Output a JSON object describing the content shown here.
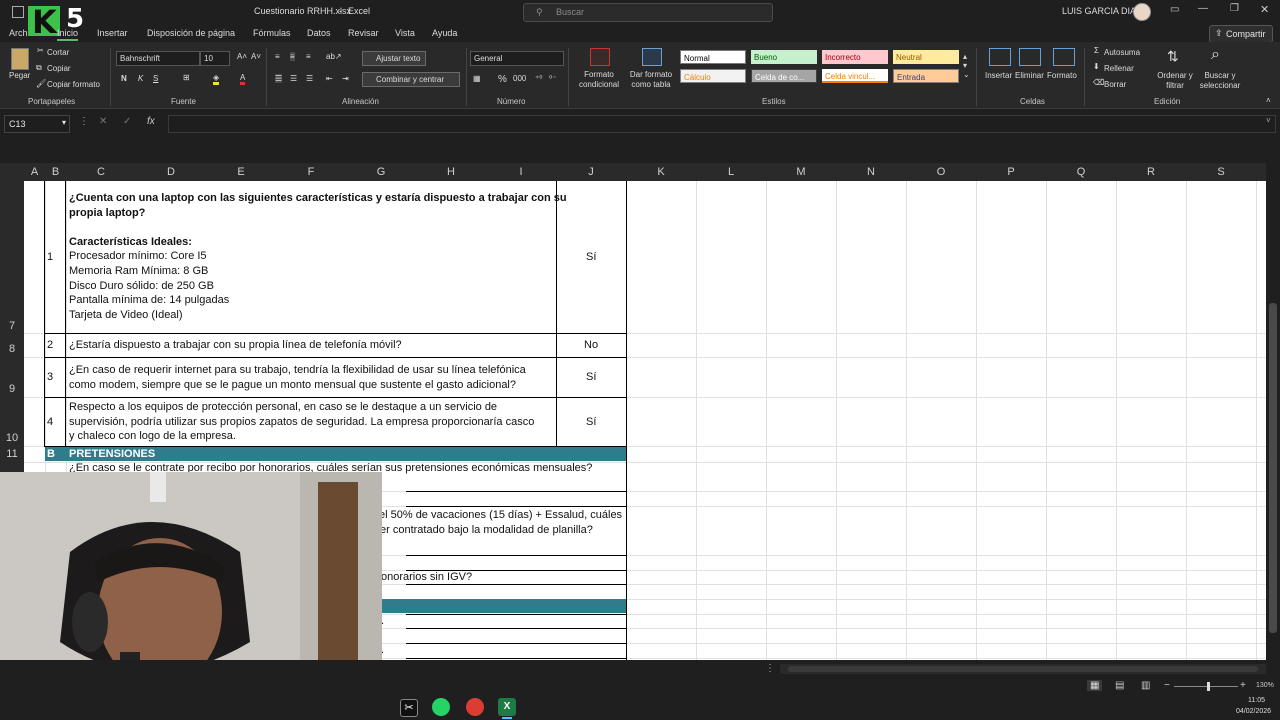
{
  "titlebar": {
    "filename": "Cuestionario RRHH.xlsx",
    "separator": "-",
    "app": "Excel",
    "search_placeholder": "Buscar",
    "user_name": "LUIS GARCIA DIAZ",
    "logo_letter": "K",
    "logo_number": "5"
  },
  "menu": {
    "items": [
      "Arch",
      "Inicio",
      "Insertar",
      "Disposición de página",
      "Fórmulas",
      "Datos",
      "Revisar",
      "Vista",
      "Ayuda"
    ],
    "share": "Compartir"
  },
  "ribbon": {
    "clipboard": {
      "paste": "Pegar",
      "cut": "Cortar",
      "copy": "Copiar",
      "format_painter": "Copiar formato",
      "group": "Portapapeles"
    },
    "font": {
      "name": "Bahnschrift",
      "size": "10",
      "bold": "N",
      "italic": "K",
      "underline": "S",
      "group": "Fuente"
    },
    "alignment": {
      "wrap": "Ajustar texto",
      "merge": "Combinar y centrar",
      "group": "Alineación"
    },
    "number": {
      "format": "General",
      "group": "Número"
    },
    "styles": {
      "conditional": "Formato condicional",
      "table": "Dar formato como tabla",
      "cells": [
        "Normal",
        "Bueno",
        "Incorrecto",
        "Neutral",
        "Cálculo",
        "Celda de co...",
        "Celda vincul...",
        "Entrada"
      ],
      "group": "Estilos"
    },
    "cells_group": {
      "insert": "Insertar",
      "delete": "Eliminar",
      "format": "Formato",
      "group": "Celdas"
    },
    "editing": {
      "autosum": "Autosuma",
      "fill": "Rellenar",
      "clear": "Borrar",
      "sort": "Ordenar y filtrar",
      "find": "Buscar y seleccionar",
      "group": "Edición"
    }
  },
  "formula_bar": {
    "cell_ref": "C13",
    "fx": "fx",
    "formula": ""
  },
  "columns": [
    "A",
    "B",
    "C",
    "D",
    "E",
    "F",
    "G",
    "H",
    "I",
    "J",
    "K",
    "L",
    "M",
    "N",
    "O",
    "P",
    "Q",
    "R",
    "S"
  ],
  "row_numbers": [
    "7",
    "8",
    "9",
    "10",
    "11"
  ],
  "questions": [
    {
      "num": "1",
      "lines": [
        "¿Cuenta con una laptop con las siguientes características y estaría dispuesto a trabajar con su",
        "propia laptop?",
        "",
        "Características Ideales:",
        "Procesador mínimo: Core I5",
        "Memoria Ram Mínima: 8 GB",
        "Disco Duro sólido: de 250 GB",
        "Pantalla mínima de: 14 pulgadas",
        "Tarjeta de Video (Ideal)"
      ],
      "answer": "Sí"
    },
    {
      "num": "2",
      "lines": [
        "¿Estaría dispuesto a trabajar con su propia línea de telefonía móvil?"
      ],
      "answer": "No"
    },
    {
      "num": "3",
      "lines": [
        "¿En caso de requerir internet para su trabajo, tendría la flexibilidad de usar su línea telefónica",
        "como modem, siempre que se le pague un monto mensual que sustente el gasto adicional?"
      ],
      "answer": "Sí"
    },
    {
      "num": "4",
      "lines": [
        "Respecto a los equipos de protección personal, en caso se le destaque a un servicio de",
        "supervisión, podría utilizar sus propios zapatos de seguridad. La empresa proporcionaría casco",
        "y chaleco con logo de la empresa."
      ],
      "answer": "Sí"
    }
  ],
  "section": {
    "letter": "B",
    "title": "PRETENSIONES"
  },
  "pretensiones": [
    "¿En caso se le contrate por recibo por honorarios, cuáles serían sus pretensiones económicas mensuales?",
    "el 50% de vacaciones (15 días) + Essalud, cuáles",
    "er contratado bajo la modalidad de planilla?",
    "onorarios sin IGV?"
  ],
  "partial_cells": [
    ".",
    "."
  ],
  "status": {
    "zoom": "130%",
    "time": "11:05",
    "date": "04/02/2026"
  }
}
